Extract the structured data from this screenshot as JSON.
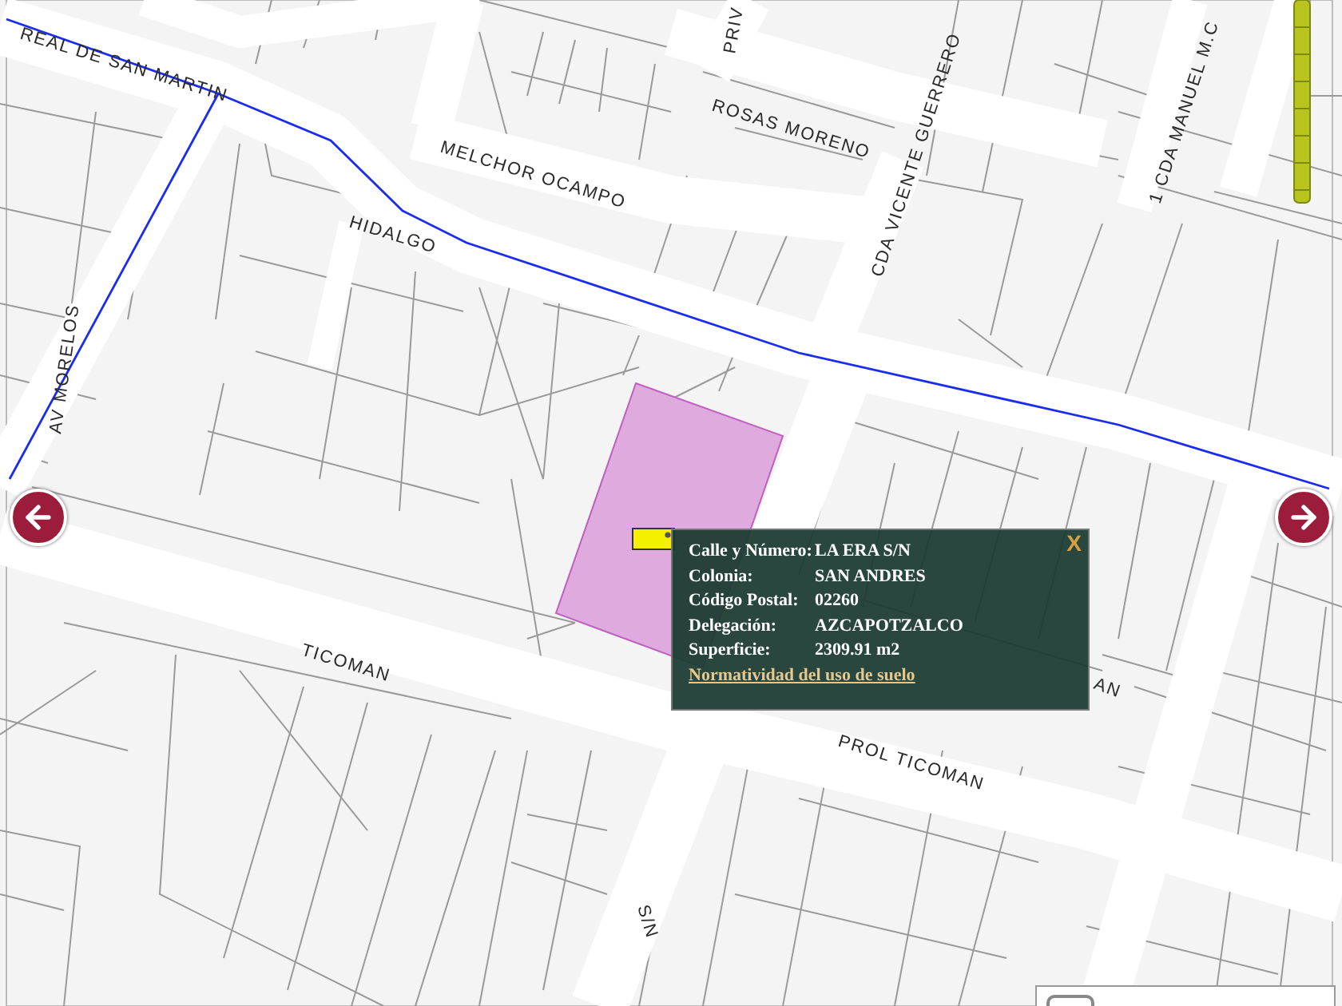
{
  "streets": [
    {
      "name": "REAL DE SAN MARTIN"
    },
    {
      "name": "MELCHOR OCAMPO"
    },
    {
      "name": "HIDALGO"
    },
    {
      "name": "ROSAS MORENO"
    },
    {
      "name": "CDA VICENTE GUERRERO"
    },
    {
      "name": "PRIV"
    },
    {
      "name": "1 CDA MANUEL M.C"
    },
    {
      "name": "AV MORELOS"
    },
    {
      "name": "TICOMAN"
    },
    {
      "name": "PROL TICOMAN"
    },
    {
      "name": "AN"
    },
    {
      "name": "S/N"
    }
  ],
  "popup": {
    "close": "X",
    "fields": [
      {
        "label": "Calle y Número:",
        "value": "LA ERA S/N"
      },
      {
        "label": "Colonia:",
        "value": "SAN ANDRES"
      },
      {
        "label": "Código Postal:",
        "value": "02260"
      },
      {
        "label": "Delegación:",
        "value": "AZCAPOTZALCO"
      },
      {
        "label": "Superficie:",
        "value": "2309.91 m2"
      }
    ],
    "link": "Normatividad del uso de suelo"
  }
}
